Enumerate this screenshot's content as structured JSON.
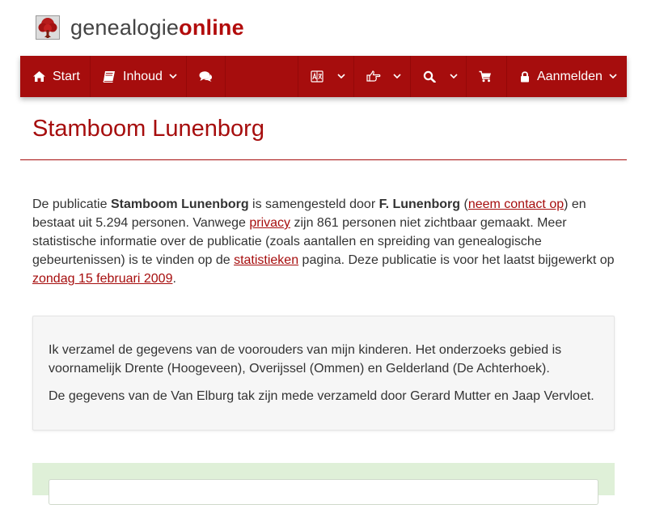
{
  "logo": {
    "brand_light": "genealogie",
    "brand_bold": "online",
    "icon": "tree-icon",
    "brand_color": "#b20c0c"
  },
  "nav": {
    "background": "#a60d0d",
    "items": [
      {
        "label": "Start",
        "icon": "home-icon"
      },
      {
        "label": "Inhoud",
        "icon": "book-icon",
        "dropdown": true
      },
      {
        "label": "",
        "icon": "comments-icon"
      },
      {
        "label": "",
        "icon": "language-icon",
        "dropdown": true
      },
      {
        "label": "",
        "icon": "hand-pointer-icon",
        "dropdown": true
      },
      {
        "label": "",
        "icon": "search-icon",
        "dropdown": true
      },
      {
        "label": "",
        "icon": "cart-icon"
      },
      {
        "label": "Aanmelden",
        "icon": "lock-icon",
        "dropdown": true
      }
    ]
  },
  "page": {
    "title": "Stamboom Lunenborg"
  },
  "intro": {
    "t1": "De publicatie ",
    "publication": "Stamboom Lunenborg",
    "t2": " is samengesteld door ",
    "author": "F. Lunenborg",
    "t3": " (",
    "contact_link": "neem contact op",
    "t4": ") en bestaat uit 5.294 personen. Vanwege ",
    "privacy_link": "privacy",
    "t5": " zijn 861 personen niet zichtbaar gemaakt. Meer statistische informatie over de publicatie (zoals aantallen en spreiding van genealogische gebeurtenissen) is te vinden op de ",
    "stats_link": "statistieken",
    "t6": " pagina. Deze publicatie is voor het laatst bijgewerkt op ",
    "date_link": "zondag 15 februari 2009",
    "t7": "."
  },
  "description": {
    "p1": "Ik verzamel de gegevens van de voorouders van mijn kinderen. Het onderzoeks gebied is voornamelijk Drente (Hoogeveen), Overijssel (Ommen) en Gelderland (De Achterhoek).",
    "p2": "De gegevens van de Van Elburg tak zijn mede verzameld door Gerard Mutter en Jaap Vervloet."
  },
  "colors": {
    "accent": "#a60d0d",
    "panel_green": "#dff0d8",
    "box_grey": "#f6f6f6"
  }
}
